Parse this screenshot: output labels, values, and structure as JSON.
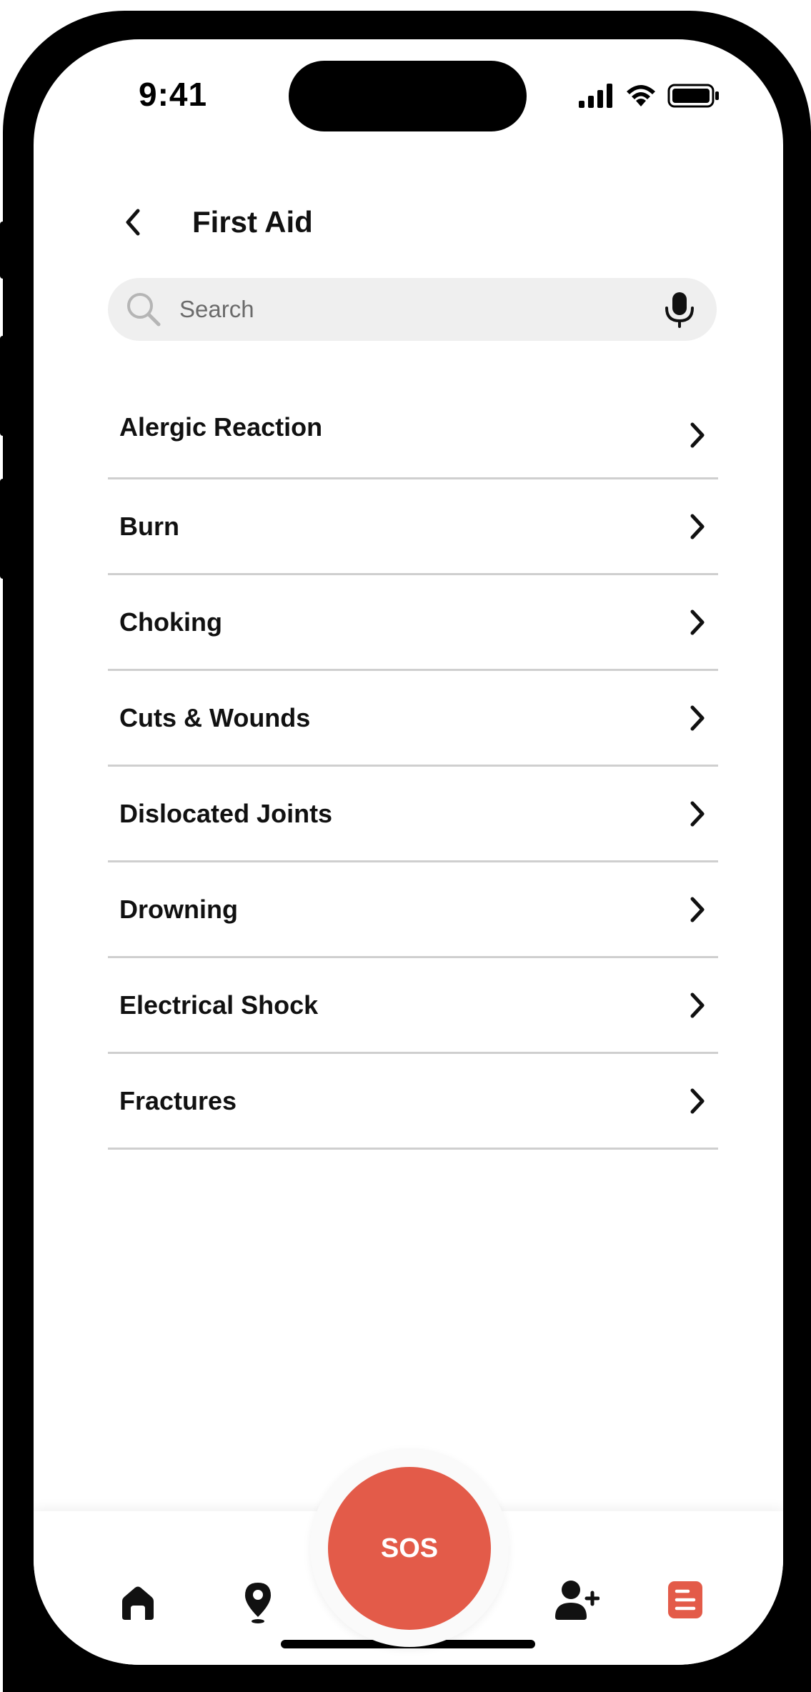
{
  "status_bar": {
    "time": "9:41"
  },
  "header": {
    "title": "First Aid",
    "back_icon": "chevron-left-icon"
  },
  "search": {
    "placeholder": "Search",
    "search_icon": "search-icon",
    "mic_icon": "microphone-icon"
  },
  "topics": {
    "items": [
      {
        "label": "Alergic Reaction"
      },
      {
        "label": "Burn"
      },
      {
        "label": "Choking"
      },
      {
        "label": "Cuts & Wounds"
      },
      {
        "label": "Dislocated Joints"
      },
      {
        "label": "Drowning"
      },
      {
        "label": "Electrical Shock"
      },
      {
        "label": "Fractures"
      }
    ]
  },
  "tab_bar": {
    "sos_label": "SOS",
    "sos_color": "#e35b49",
    "active_color": "#e35b49",
    "tabs": [
      {
        "icon": "home-icon"
      },
      {
        "icon": "location-pin-icon"
      },
      {
        "icon": "add-contact-icon"
      },
      {
        "icon": "first-aid-document-icon",
        "active": true
      }
    ]
  }
}
